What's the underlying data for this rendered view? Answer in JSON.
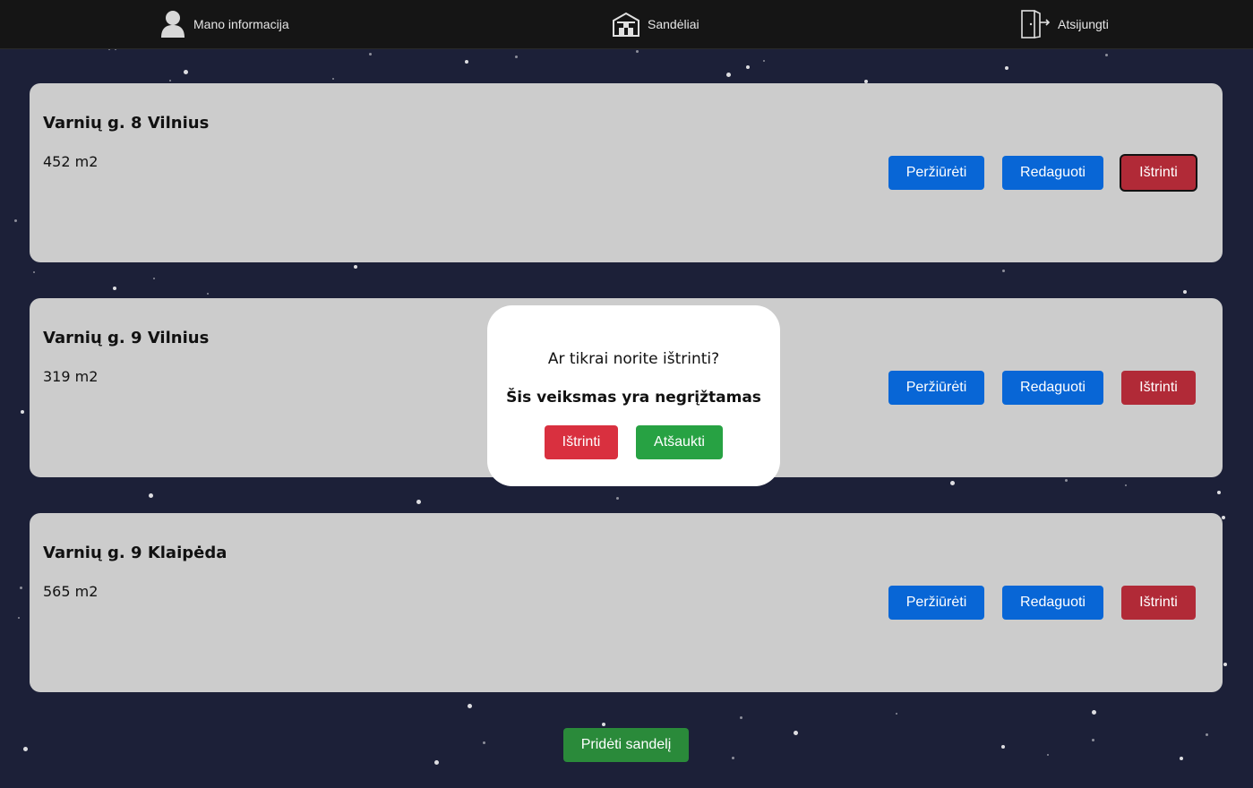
{
  "nav": {
    "profile_label": "Mano informacija",
    "profile_icon": "user-icon",
    "warehouses_label": "Sandėliai",
    "warehouses_icon": "warehouse-icon",
    "logout_label": "Atsijungti",
    "logout_icon": "logout-door-icon"
  },
  "warehouses": [
    {
      "title": "Varnių g. 8 Vilnius",
      "area": "452 m2",
      "view_label": "Peržiūrėti",
      "edit_label": "Redaguoti",
      "delete_label": "Ištrinti"
    },
    {
      "title": "Varnių g. 9 Vilnius",
      "area": "319 m2",
      "view_label": "Peržiūrėti",
      "edit_label": "Redaguoti",
      "delete_label": "Ištrinti"
    },
    {
      "title": "Varnių g. 9 Klaipėda",
      "area": "565 m2",
      "view_label": "Peržiūrėti",
      "edit_label": "Redaguoti",
      "delete_label": "Ištrinti"
    }
  ],
  "add_warehouse_label": "Pridėti sandelį",
  "confirm_dialog": {
    "question": "Ar tikrai norite ištrinti?",
    "warning": "Šis veiksmas yra negrįžtamas",
    "confirm_label": "Ištrinti",
    "cancel_label": "Atšaukti"
  },
  "colors": {
    "background": "#1c2038",
    "topbar": "#151515",
    "card": "#cccccc",
    "primary_button": "#0866d6",
    "danger_button": "#b12a37",
    "success_button": "#2a8a3a"
  }
}
